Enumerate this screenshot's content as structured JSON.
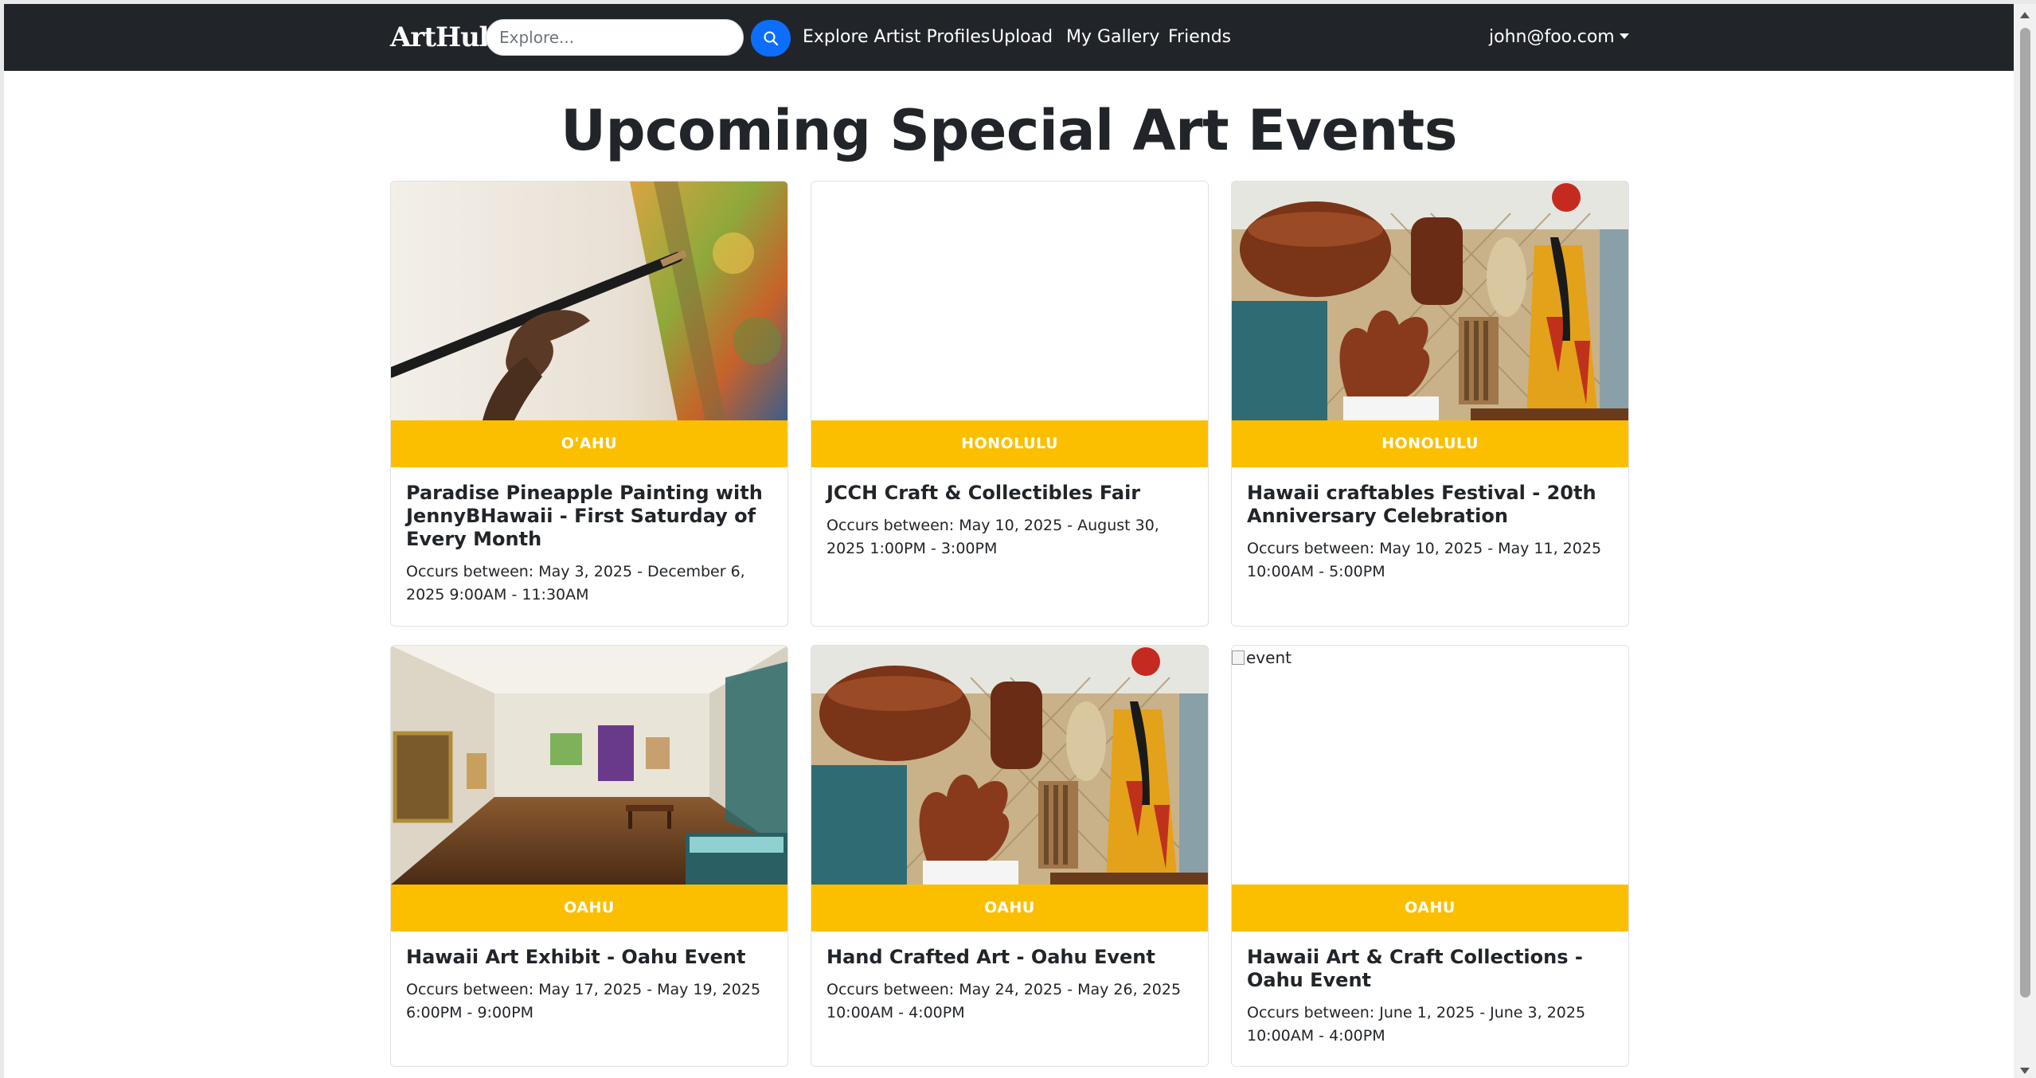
{
  "navbar": {
    "brand": "ArtHub",
    "search_placeholder": "Explore...",
    "search_icon": "search-icon",
    "links": [
      "Explore Artist Profiles",
      "Upload",
      "My Gallery",
      "Friends"
    ],
    "user": "john@foo.com"
  },
  "page_title": "Upcoming Special Art Events",
  "colors": {
    "navbar_bg": "#212529",
    "badge_bg": "#fcbf00",
    "search_button": "#0d6efd"
  },
  "events": [
    {
      "location": "O'AHU",
      "title": "Paradise Pineapple Painting with JennyBHawaii - First Saturday of Every Month",
      "dates": "Occurs between: May 3, 2025 - December 6, 2025 9:00AM - 11:30AM",
      "image": "painting-brush"
    },
    {
      "location": "HONOLULU",
      "title": "JCCH Craft & Collectibles Fair",
      "dates": "Occurs between: May 10, 2025 - August 30, 2025 1:00PM - 3:00PM",
      "image": "blank"
    },
    {
      "location": "HONOLULU",
      "title": "Hawaii craftables Festival - 20th Anniversary Celebration",
      "dates": "Occurs between: May 10, 2025 - May 11, 2025 10:00AM - 5:00PM",
      "image": "wood-crafts"
    },
    {
      "location": "OAHU",
      "title": "Hawaii Art Exhibit - Oahu Event",
      "dates": "Occurs between: May 17, 2025 - May 19, 2025 6:00PM - 9:00PM",
      "image": "gallery-room"
    },
    {
      "location": "OAHU",
      "title": "Hand Crafted Art - Oahu Event",
      "dates": "Occurs between: May 24, 2025 - May 26, 2025 10:00AM - 4:00PM",
      "image": "wood-crafts"
    },
    {
      "location": "OAHU",
      "title": "Hawaii Art & Craft Collections - Oahu Event",
      "dates": "Occurs between: June 1, 2025 - June 3, 2025 10:00AM - 4:00PM",
      "image": "broken",
      "image_alt": "event"
    }
  ]
}
